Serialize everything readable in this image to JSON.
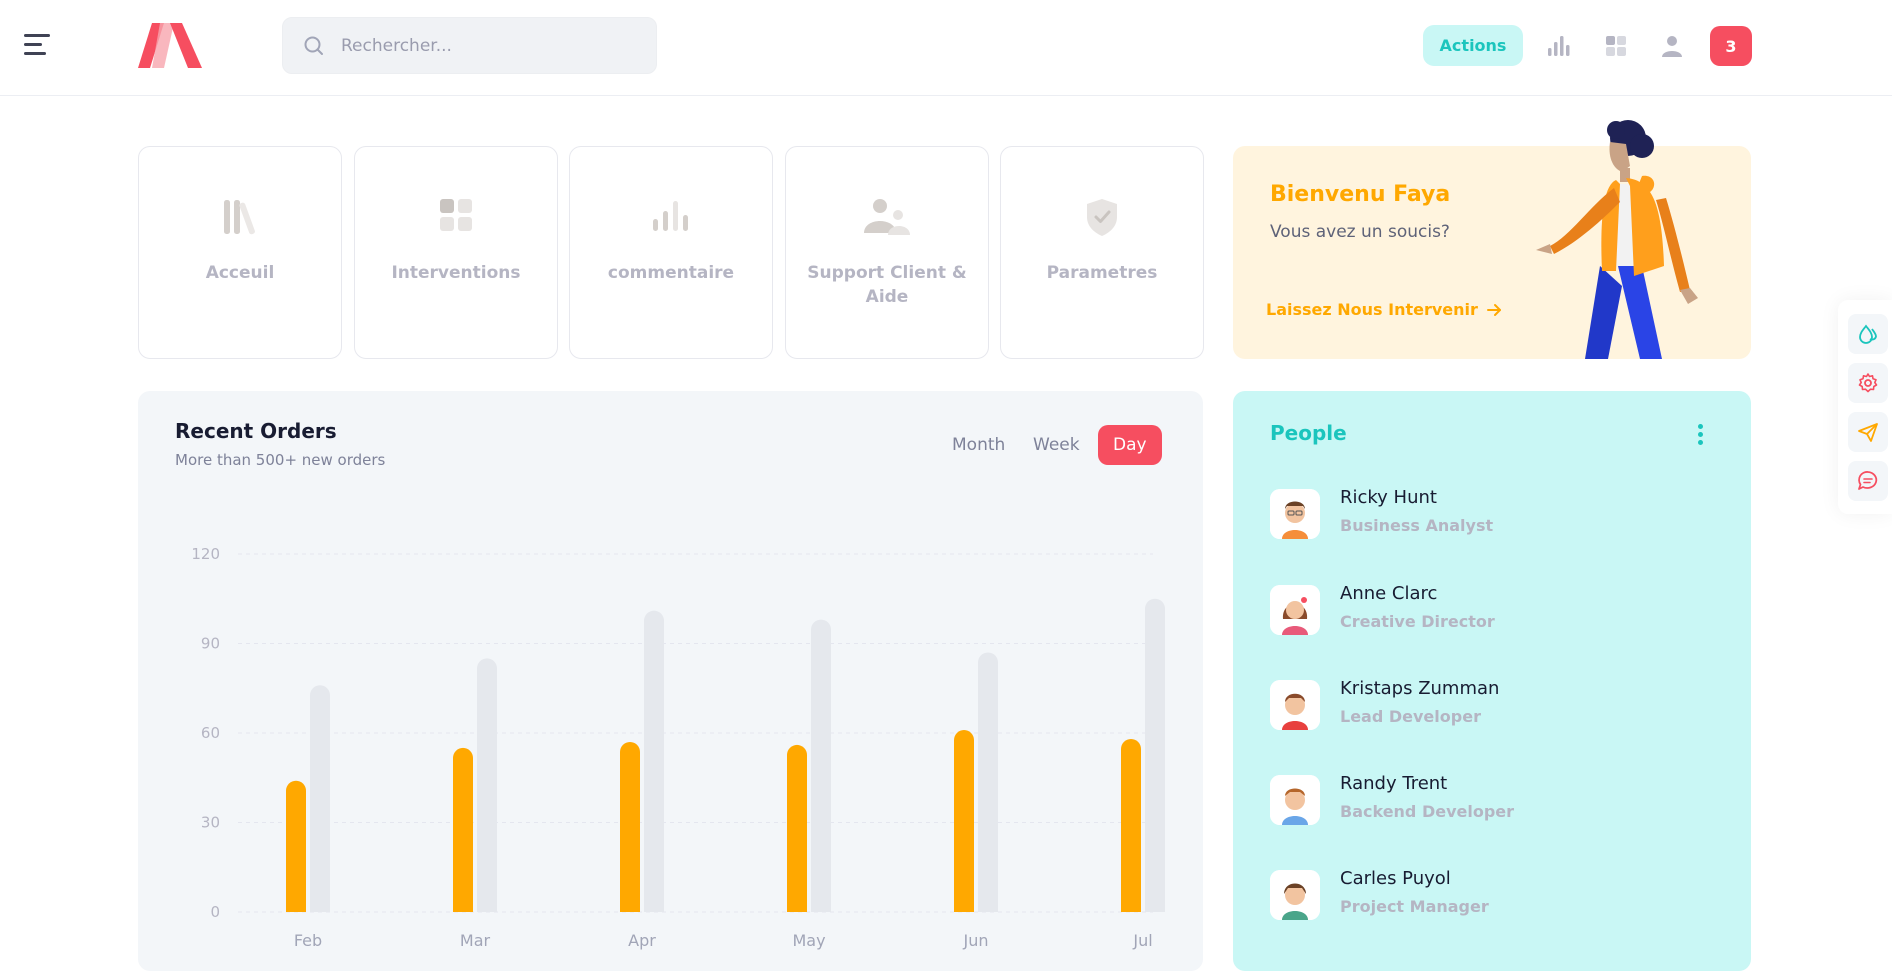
{
  "header": {
    "search_placeholder": "Rechercher...",
    "actions_label": "Actions",
    "notification_count": "3"
  },
  "tiles": [
    {
      "label": "Acceuil",
      "icon": "library-icon"
    },
    {
      "label": "Interventions",
      "icon": "grid-icon"
    },
    {
      "label": "commentaire",
      "icon": "bar-chart-icon"
    },
    {
      "label": "Support Client & Aide",
      "icon": "users-icon"
    },
    {
      "label": "Parametres",
      "icon": "shield-check-icon"
    }
  ],
  "welcome": {
    "title": "Bienvenu Faya",
    "subtitle": "Vous avez un soucis?",
    "link": "Laissez Nous Intervenir"
  },
  "orders": {
    "title": "Recent Orders",
    "subtitle": "More than 500+ new orders",
    "toggles": [
      "Month",
      "Week",
      "Day"
    ],
    "active_toggle": "Day"
  },
  "chart_data": {
    "type": "bar",
    "categories": [
      "Feb",
      "Mar",
      "Apr",
      "May",
      "Jun",
      "Jul"
    ],
    "series": [
      {
        "values": [
          44,
          55,
          57,
          56,
          61,
          58
        ],
        "color": "#ffa800"
      },
      {
        "values": [
          76,
          85,
          101,
          98,
          87,
          105
        ],
        "color": "#e5e8ed"
      }
    ],
    "y_ticks": [
      "0",
      "30",
      "60",
      "90",
      "120"
    ],
    "ylim": [
      0,
      120
    ],
    "grid": true
  },
  "people": {
    "title": "People",
    "items": [
      {
        "name": "Ricky Hunt",
        "role": "Business Analyst"
      },
      {
        "name": "Anne Clarc",
        "role": "Creative Director"
      },
      {
        "name": "Kristaps Zumman",
        "role": "Lead Developer"
      },
      {
        "name": "Randy Trent",
        "role": "Backend Developer"
      },
      {
        "name": "Carles Puyol",
        "role": "Project Manager"
      }
    ]
  },
  "colors": {
    "accent_red": "#f64e60",
    "accent_teal": "#1bc5bd",
    "accent_orange": "#ffa800"
  }
}
